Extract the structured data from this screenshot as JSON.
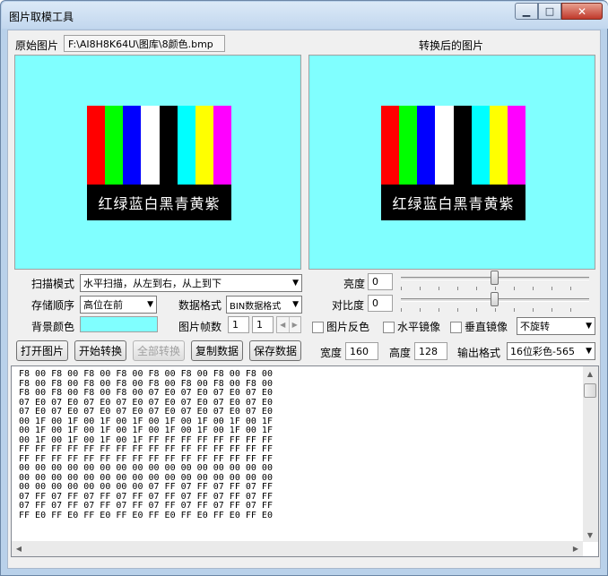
{
  "window": {
    "title": "图片取模工具"
  },
  "source": {
    "label": "原始图片",
    "path": "F:\\AI8H8K64U\\图库\\8颜色.bmp"
  },
  "converted": {
    "label": "转换后的图片"
  },
  "image": {
    "bar_colors": [
      "#ff0000",
      "#00ff00",
      "#0000ff",
      "#ffffff",
      "#000000",
      "#00ffff",
      "#ffff00",
      "#ff00ff"
    ],
    "caption": "红绿蓝白黑青黄紫"
  },
  "controls": {
    "scan_mode_label": "扫描模式",
    "scan_mode_value": "水平扫描，从左到右，从上到下",
    "storage_order_label": "存储顺序",
    "storage_order_value": "高位在前",
    "data_format_label": "数据格式",
    "data_format_value": "BIN数据格式",
    "bg_color_label": "背景颜色",
    "bg_color": "#80ffff",
    "frames_label": "图片帧数",
    "frames_a": "1",
    "frames_b": "1",
    "brightness_label": "亮度",
    "brightness_value": "0",
    "contrast_label": "对比度",
    "contrast_value": "0",
    "invert_label": "图片反色",
    "hmirror_label": "水平镜像",
    "vmirror_label": "垂直镜像",
    "rotate_value": "不旋转",
    "width_label": "宽度",
    "width_value": "160",
    "height_label": "高度",
    "height_value": "128",
    "output_format_label": "输出格式",
    "output_format_value": "16位彩色-565"
  },
  "buttons": {
    "open": "打开图片",
    "start": "开始转换",
    "convert_all": "全部转换",
    "copy": "复制数据",
    "save": "保存数据"
  },
  "output": {
    "lines": [
      "F8 00 F8 00 F8 00 F8 00 F8 00 F8 00 F8 00 F8 00",
      "F8 00 F8 00 F8 00 F8 00 F8 00 F8 00 F8 00 F8 00",
      "F8 00 F8 00 F8 00 F8 00 07 E0 07 E0 07 E0 07 E0",
      "07 E0 07 E0 07 E0 07 E0 07 E0 07 E0 07 E0 07 E0",
      "07 E0 07 E0 07 E0 07 E0 07 E0 07 E0 07 E0 07 E0",
      "00 1F 00 1F 00 1F 00 1F 00 1F 00 1F 00 1F 00 1F",
      "00 1F 00 1F 00 1F 00 1F 00 1F 00 1F 00 1F 00 1F",
      "00 1F 00 1F 00 1F 00 1F FF FF FF FF FF FF FF FF",
      "FF FF FF FF FF FF FF FF FF FF FF FF FF FF FF FF",
      "FF FF FF FF FF FF FF FF FF FF FF FF FF FF FF FF",
      "00 00 00 00 00 00 00 00 00 00 00 00 00 00 00 00",
      "00 00 00 00 00 00 00 00 00 00 00 00 00 00 00 00",
      "00 00 00 00 00 00 00 00 07 FF 07 FF 07 FF 07 FF",
      "07 FF 07 FF 07 FF 07 FF 07 FF 07 FF 07 FF 07 FF",
      "07 FF 07 FF 07 FF 07 FF 07 FF 07 FF 07 FF 07 FF",
      "FF E0 FF E0 FF E0 FF E0 FF E0 FF E0 FF E0 FF E0"
    ]
  }
}
